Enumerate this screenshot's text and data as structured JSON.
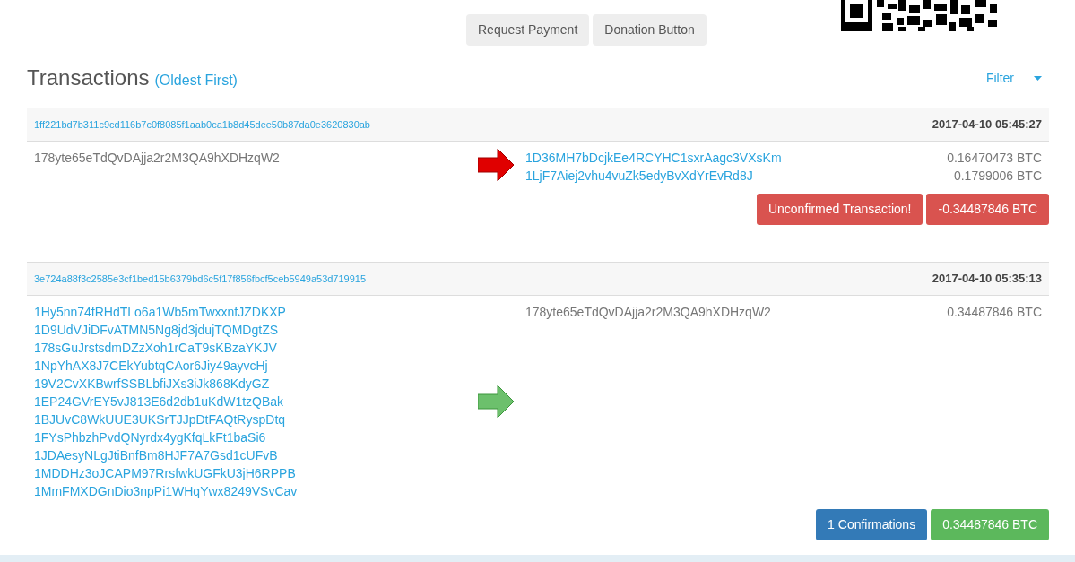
{
  "top_buttons": [
    "Request Payment",
    "Donation Button"
  ],
  "heading": {
    "title": "Transactions",
    "order_link": "(Oldest First)",
    "filter": "Filter"
  },
  "transactions": [
    {
      "hash": "1ff221bd7b311c9cd116b7c0f8085f1aab0ca1b8d45dee50b87da0e3620830ab",
      "time": "2017-04-10 05:45:27",
      "kind": "sent",
      "inputs": [
        {
          "address": "178yte65eTdQvDAjja2r2M3QA9hXDHzqW2",
          "own": true
        }
      ],
      "outputs": [
        {
          "address": "1D36MH7bDcjkEe4RCYHC1sxrAagc3VXsKm",
          "own": false,
          "amount": "0.16470473 BTC"
        },
        {
          "address": "1LjF7Aiej2vhu4vuZk5edyBvXdYrEvRd8J",
          "own": false,
          "amount": "0.1799006 BTC"
        }
      ],
      "badges": [
        {
          "text": "Unconfirmed Transaction!",
          "kind": "danger"
        },
        {
          "text": "-0.34487846 BTC",
          "kind": "danger"
        }
      ]
    },
    {
      "hash": "3e724a88f3c2585e3cf1bed15b6379bd6c5f17f856fbcf5ceb5949a53d719915",
      "time": "2017-04-10 05:35:13",
      "kind": "received",
      "inputs": [
        {
          "address": "1Hy5nn74fRHdTLo6a1Wb5mTwxxnfJZDKXP",
          "own": false
        },
        {
          "address": "1D9UdVJiDFvATMN5Ng8jd3jdujTQMDgtZS",
          "own": false
        },
        {
          "address": "178sGuJrstsdmDZzXoh1rCaT9sKBzaYKJV",
          "own": false
        },
        {
          "address": "1NpYhAX8J7CEkYubtqCAor6Jiy49ayvcHj",
          "own": false
        },
        {
          "address": "19V2CvXKBwrfSSBLbfiJXs3iJk868KdyGZ",
          "own": false
        },
        {
          "address": "1EP24GVrEY5vJ813E6d2db1uKdW1tzQBak",
          "own": false
        },
        {
          "address": "1BJUvC8WkUUE3UKSrTJJpDtFAQtRyspDtq",
          "own": false
        },
        {
          "address": "1FYsPhbzhPvdQNyrdx4ygKfqLkFt1baSi6",
          "own": false
        },
        {
          "address": "1JDAesyNLgJtiBnfBm8HJF7A7Gsd1cUFvB",
          "own": false
        },
        {
          "address": "1MDDHz3oJCAPM97RrsfwkUGFkU3jH6RPPB",
          "own": false
        },
        {
          "address": "1MmFMXDGnDio3npPi1WHqYwx8249VSvCav",
          "own": false
        }
      ],
      "outputs": [
        {
          "address": "178yte65eTdQvDAjja2r2M3QA9hXDHzqW2",
          "own": true,
          "amount": "0.34487846 BTC"
        }
      ],
      "badges": [
        {
          "text": "1 Confirmations",
          "kind": "primary"
        },
        {
          "text": "0.34487846 BTC",
          "kind": "success"
        }
      ]
    }
  ]
}
